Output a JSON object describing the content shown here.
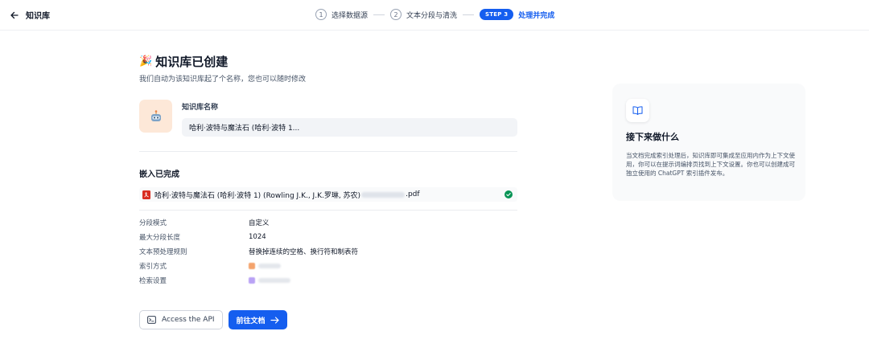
{
  "header": {
    "title": "知识库",
    "steps": [
      {
        "num": "1",
        "label": "选择数据源"
      },
      {
        "num": "2",
        "label": "文本分段与清洗"
      },
      {
        "badge": "STEP 3",
        "label": "处理并完成"
      }
    ]
  },
  "main": {
    "title": "知识库已创建",
    "subtitle": "我们自动为该知识库起了个名称，您也可以随时修改",
    "name_label": "知识库名称",
    "name_value": "哈利·波特与魔法石 (哈利·波特 1...",
    "embed_title": "嵌入已完成",
    "file_name_prefix": "哈利·波特与魔法石 (哈利·波特 1) (Rowling J.K., J.K.罗琳, 苏农)",
    "file_name_suffix": ".pdf",
    "settings": [
      {
        "key": "分段模式",
        "value": "自定义"
      },
      {
        "key": "最大分段长度",
        "value": "1024"
      },
      {
        "key": "文本预处理规则",
        "value": "替换掉连续的空格、换行符和制表符"
      },
      {
        "key": "索引方式",
        "value": ""
      },
      {
        "key": "检索设置",
        "value": ""
      }
    ],
    "api_button": "Access the API",
    "docs_button": "前往文档"
  },
  "card": {
    "title": "接下来做什么",
    "text": "当文档完成索引处理后，知识库即可集成至应用内作为上下文使用，你可以在提示词编排页找到上下文设置。你也可以创建成可独立使用的 ChatGPT 索引插件发布。"
  },
  "colors": {
    "accent": "#155eef",
    "success": "#079455",
    "pdf": "#d92d20",
    "kb_icon_bg": "#fde8d8"
  }
}
